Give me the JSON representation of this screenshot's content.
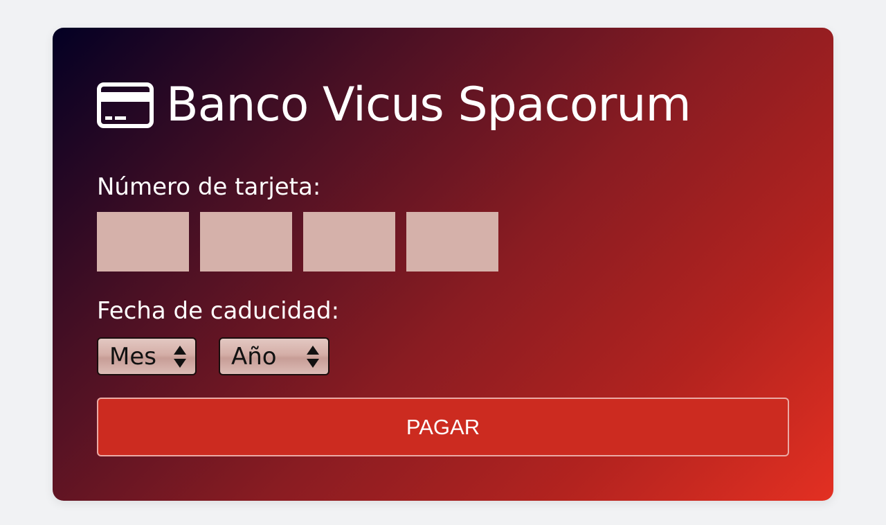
{
  "brand": {
    "title": "Banco Vicus Spacorum",
    "icon": "credit-card-icon"
  },
  "form": {
    "card_number_label": "Número de tarjeta:",
    "card_number_fields": [
      "",
      "",
      "",
      ""
    ],
    "expiry_label": "Fecha de caducidad:",
    "month_select_value": "Mes",
    "year_select_value": "Año",
    "submit_label": "PAGAR"
  },
  "colors": {
    "gradient_start": "#030024",
    "gradient_end": "#e33022",
    "input_fill": "#d5b1aa",
    "button_fill": "#cc2b20"
  }
}
